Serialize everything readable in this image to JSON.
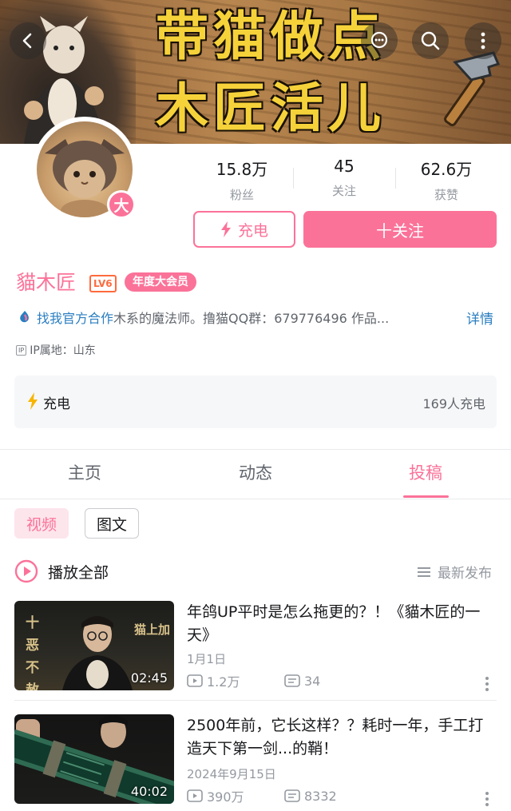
{
  "banner": {
    "line1": "带猫做点",
    "line2": "木匠活儿"
  },
  "icons": {
    "back": "back-arrow-icon",
    "chat": "chat-bubble-icon",
    "search": "search-icon",
    "more": "more-vertical-icon"
  },
  "profile": {
    "avatar_badge": "大",
    "stats": [
      {
        "num": "15.8万",
        "label": "粉丝"
      },
      {
        "num": "45",
        "label": "关注"
      },
      {
        "num": "62.6万",
        "label": "获赞"
      }
    ],
    "charge_label": "充电",
    "follow_label": "十关注",
    "name": "貓木匠",
    "level": "LV6",
    "vip": "年度大会员",
    "bio_link": "找我官方合作",
    "bio_text": "木系的魔法师。撸猫QQ群：679776496  作品...",
    "detail_label": "详情",
    "ip_tag": "IP",
    "ip_text": "IP属地：山东"
  },
  "charge_card": {
    "label": "充电",
    "count": "169人充电"
  },
  "tabs": [
    {
      "label": "主页"
    },
    {
      "label": "动态"
    },
    {
      "label": "投稿"
    }
  ],
  "filters": [
    {
      "label": "视频"
    },
    {
      "label": "图文"
    }
  ],
  "list": {
    "play_all": "播放全部",
    "sort": "最新发布"
  },
  "videos": [
    {
      "title": "年鸽UP平时是怎么拖更的？！《貓木匠的一天》",
      "date": "1月1日",
      "views": "1.2万",
      "danmaku": "34",
      "duration": "02:45",
      "overlay_left": "十恶不赦",
      "overlay_right": "猫上加"
    },
    {
      "title": "2500年前，它长这样？？耗时一年，手工打造天下第一剑...的鞘！",
      "date": "2024年9月15日",
      "views": "390万",
      "danmaku": "8332",
      "duration": "40:02"
    }
  ],
  "colors": {
    "accent": "#fb7299",
    "link": "#2a7ec1",
    "banner_text": "#f6d23a"
  }
}
